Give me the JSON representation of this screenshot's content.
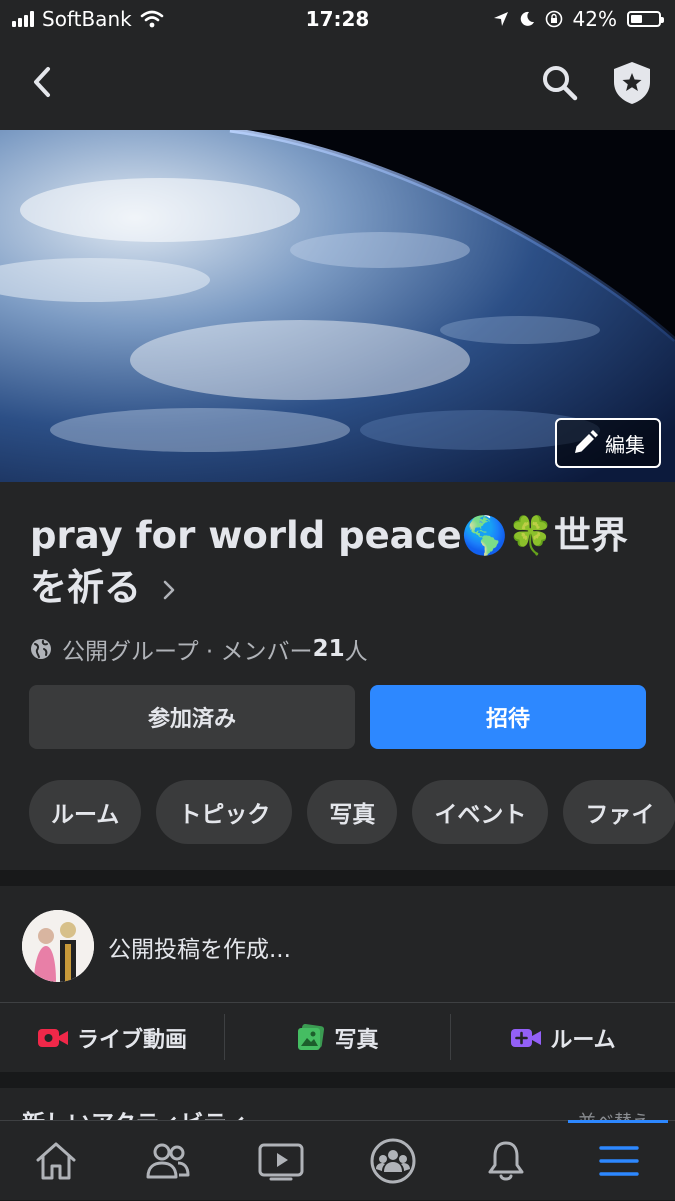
{
  "status_bar": {
    "carrier": "SoftBank",
    "time": "17:28",
    "battery": "42%",
    "battery_level": 0.42
  },
  "nav": {
    "back_icon": "chevron-left-icon",
    "search_icon": "search-icon",
    "admin_icon": "shield-star-icon"
  },
  "cover": {
    "edit_label": "編集"
  },
  "group": {
    "name": "pray for world peace🌎🍀世界を祈る",
    "privacy": "公開グループ · メンバー",
    "member_count": "21",
    "member_suffix": "人",
    "joined_label": "参加済み",
    "invite_label": "招待",
    "tabs": [
      "ルーム",
      "トピック",
      "写真",
      "イベント",
      "ファイ"
    ]
  },
  "composer": {
    "prompt": "公開投稿を作成...",
    "actions": [
      {
        "label": "ライブ動画",
        "icon": "live-video-icon",
        "color": "#f02849"
      },
      {
        "label": "写真",
        "icon": "photo-icon",
        "color": "#45bd62"
      },
      {
        "label": "ルーム",
        "icon": "room-icon",
        "color": "#9360f7"
      }
    ]
  },
  "activity": {
    "title": "新しいアクティビティ",
    "sort_label": "並べ替え"
  },
  "tab_bar": {
    "items": [
      "home-icon",
      "friends-icon",
      "watch-icon",
      "groups-icon",
      "notifications-icon",
      "menu-icon"
    ],
    "active": "menu-icon"
  },
  "colors": {
    "accent": "#2d88ff",
    "surface": "#242526",
    "background": "#18191a",
    "chip": "#3a3b3c"
  }
}
